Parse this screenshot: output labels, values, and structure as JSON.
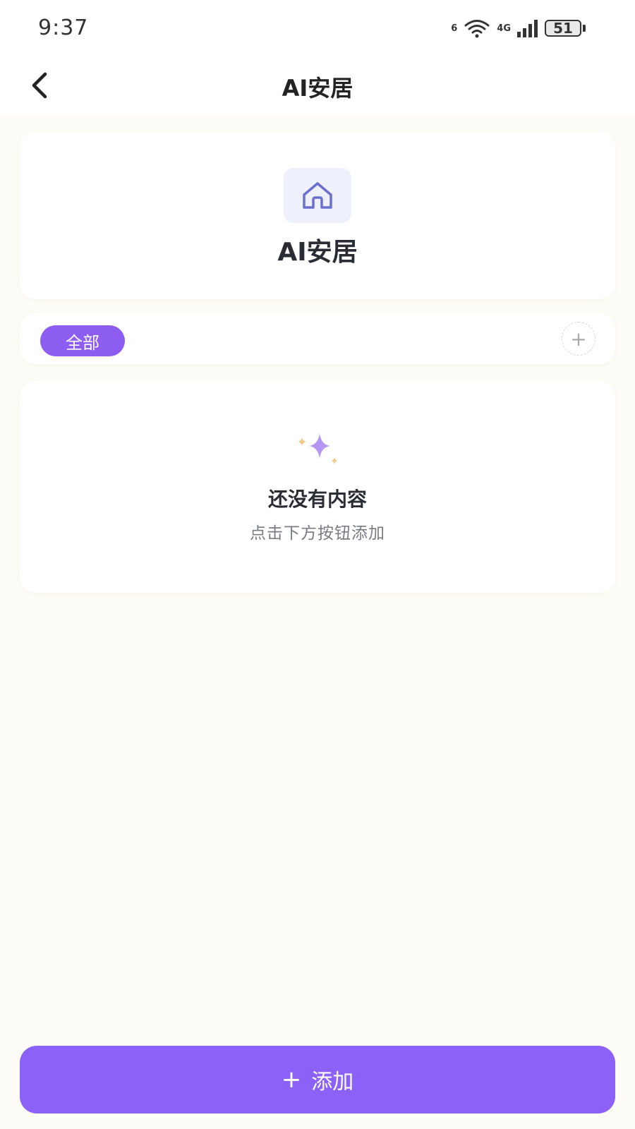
{
  "status_bar": {
    "time": "9:37",
    "wifi_label": "6",
    "network_label": "4G",
    "battery_level": "51",
    "icons": [
      "wifi-icon",
      "cellular-signal-icon",
      "battery-icon"
    ]
  },
  "nav": {
    "title": "AI安居",
    "back_icon": "chevron-left-icon"
  },
  "header": {
    "icon": "home-icon",
    "title": "AI安居"
  },
  "tabs": {
    "items": [
      {
        "label": "全部",
        "active": true
      }
    ],
    "add_label": "+"
  },
  "empty_state": {
    "icon": "sparkle-icon",
    "title": "还没有内容",
    "subtitle": "点击下方按钮添加"
  },
  "add_button": {
    "plus": "+",
    "label": "添加"
  },
  "colors": {
    "accent": "#8b61f8",
    "tab_active": "#8d5cf0",
    "background": "#fdfcf7",
    "icon_box": "#eef0fc",
    "home_icon": "#6b6fcf",
    "sparkle_main": "#b596f0",
    "sparkle_small": "#f3c98a"
  }
}
